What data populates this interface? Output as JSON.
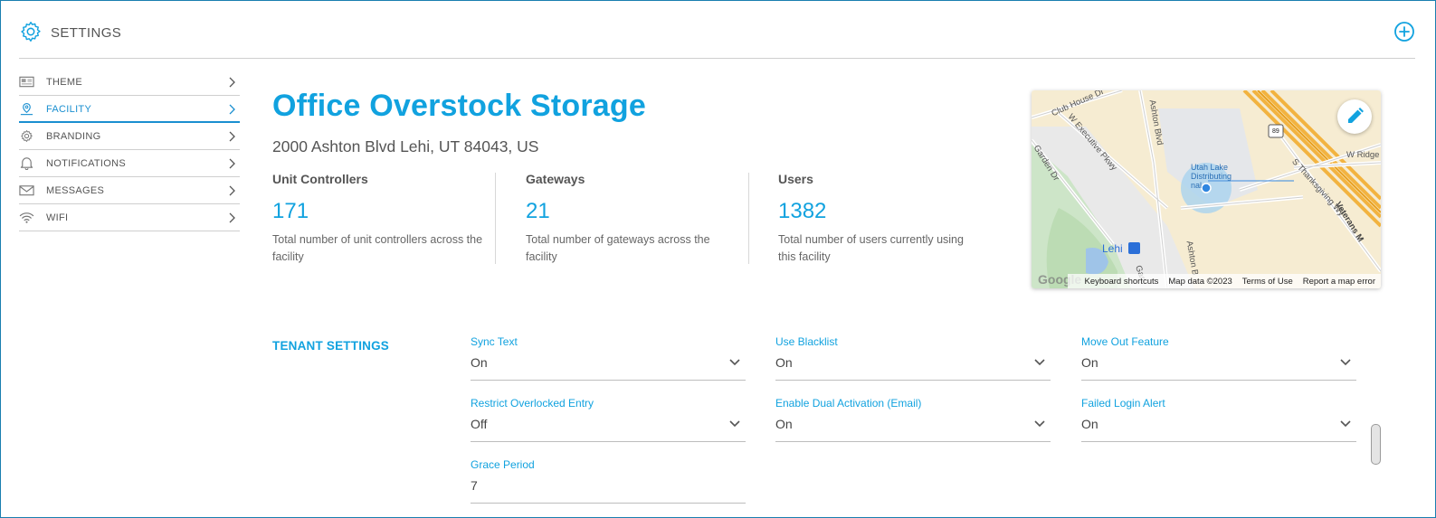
{
  "header": {
    "title": "SETTINGS",
    "icon": "gear-icon",
    "add_icon": "plus-circle-icon"
  },
  "sidebar": {
    "items": [
      {
        "label": "THEME",
        "icon": "theme-icon",
        "active": false
      },
      {
        "label": "FACILITY",
        "icon": "location-icon",
        "active": true
      },
      {
        "label": "BRANDING",
        "icon": "gear-icon",
        "active": false
      },
      {
        "label": "NOTIFICATIONS",
        "icon": "bell-icon",
        "active": false
      },
      {
        "label": "MESSAGES",
        "icon": "envelope-icon",
        "active": false
      },
      {
        "label": "WIFI",
        "icon": "wifi-icon",
        "active": false
      }
    ]
  },
  "facility": {
    "name": "Office Overstock Storage",
    "address": "2000 Ashton Blvd Lehi, UT 84043, US"
  },
  "stats": [
    {
      "label": "Unit Controllers",
      "value": "171",
      "description": "Total number of unit controllers across the facility"
    },
    {
      "label": "Gateways",
      "value": "21",
      "description": "Total number of gateways across the facility"
    },
    {
      "label": "Users",
      "value": "1382",
      "description": "Total number of users currently using this facility"
    }
  ],
  "map": {
    "edit_icon": "pencil-icon",
    "streets": [
      "Club House Dr",
      "Ashton Blvd",
      "W Executive Pkwy",
      "Garden Dr",
      "W Ridge",
      "S Thanksgiving Wy",
      "Veterans M",
      "Lehi",
      "Ashton B",
      "Gar"
    ],
    "poi": "Utah Lake Distributing nal",
    "route_shield": "89",
    "logo": "Google",
    "footer": [
      "Keyboard shortcuts",
      "Map data ©2023",
      "Terms of Use",
      "Report a map error"
    ]
  },
  "tenant_settings": {
    "title": "TENANT SETTINGS",
    "fields": [
      {
        "label": "Sync Text",
        "value": "On",
        "type": "select"
      },
      {
        "label": "Use Blacklist",
        "value": "On",
        "type": "select"
      },
      {
        "label": "Move Out Feature",
        "value": "On",
        "type": "select"
      },
      {
        "label": "Restrict Overlocked Entry",
        "value": "Off",
        "type": "select"
      },
      {
        "label": "Enable Dual Activation (Email)",
        "value": "On",
        "type": "select"
      },
      {
        "label": "Failed Login Alert",
        "value": "On",
        "type": "select"
      },
      {
        "label": "Grace Period",
        "value": "7",
        "type": "text"
      }
    ]
  },
  "colors": {
    "accent": "#11a2df",
    "text": "#555555",
    "divider": "#cfcfcf"
  }
}
